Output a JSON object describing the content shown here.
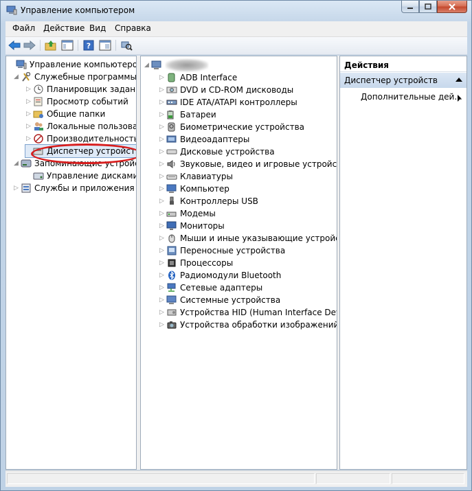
{
  "window": {
    "title": "Управление компьютером"
  },
  "menu": {
    "items": [
      "Файл",
      "Действие",
      "Вид",
      "Справка"
    ]
  },
  "toolbar": {
    "icons": [
      "back-arrow-icon",
      "forward-arrow-icon",
      "up-folder-icon",
      "show-hide-tree-icon",
      "help-icon",
      "properties-icon",
      "scan-hardware-icon"
    ]
  },
  "left_tree": {
    "items": [
      {
        "label": "Управление компьютером (л",
        "icon": "computer-management-icon",
        "expander": "▸"
      },
      {
        "label": "Служебные программы",
        "icon": "tools-icon",
        "expander": "◢"
      },
      {
        "label": "Планировщик заданий",
        "icon": "clock-icon",
        "expander": "▷"
      },
      {
        "label": "Просмотр событий",
        "icon": "event-viewer-icon",
        "expander": "▷"
      },
      {
        "label": "Общие папки",
        "icon": "shared-folder-icon",
        "expander": "▷"
      },
      {
        "label": "Локальные пользовате",
        "icon": "users-icon",
        "expander": "▷"
      },
      {
        "label": "Производительность",
        "icon": "performance-icon",
        "expander": "▷"
      },
      {
        "label": "Диспетчер устройств",
        "icon": "device-manager-icon",
        "expander": ""
      },
      {
        "label": "Запоминающие устройст",
        "icon": "storage-icon",
        "expander": "◢"
      },
      {
        "label": "Управление дисками",
        "icon": "disk-management-icon",
        "expander": ""
      },
      {
        "label": "Службы и приложения",
        "icon": "services-icon",
        "expander": "▷"
      }
    ]
  },
  "device_tree": {
    "root_expander": "◢",
    "items": [
      {
        "label": "ADB Interface",
        "icon": "adb-icon"
      },
      {
        "label": "DVD и CD-ROM дисководы",
        "icon": "dvd-icon"
      },
      {
        "label": "IDE ATA/ATAPI контроллеры",
        "icon": "ide-icon"
      },
      {
        "label": "Батареи",
        "icon": "battery-icon"
      },
      {
        "label": "Биометрические устройства",
        "icon": "biometric-icon"
      },
      {
        "label": "Видеоадаптеры",
        "icon": "video-adapter-icon"
      },
      {
        "label": "Дисковые устройства",
        "icon": "disk-drive-icon"
      },
      {
        "label": "Звуковые, видео и игровые устройства",
        "icon": "sound-icon"
      },
      {
        "label": "Клавиатуры",
        "icon": "keyboard-icon"
      },
      {
        "label": "Компьютер",
        "icon": "computer-icon"
      },
      {
        "label": "Контроллеры USB",
        "icon": "usb-icon"
      },
      {
        "label": "Модемы",
        "icon": "modem-icon"
      },
      {
        "label": "Мониторы",
        "icon": "monitor-icon"
      },
      {
        "label": "Мыши и иные указывающие устройства",
        "icon": "mouse-icon"
      },
      {
        "label": "Переносные устройства",
        "icon": "portable-device-icon"
      },
      {
        "label": "Процессоры",
        "icon": "processor-icon"
      },
      {
        "label": "Радиомодули Bluetooth",
        "icon": "bluetooth-icon"
      },
      {
        "label": "Сетевые адаптеры",
        "icon": "network-adapter-icon"
      },
      {
        "label": "Системные устройства",
        "icon": "system-device-icon"
      },
      {
        "label": "Устройства HID (Human Interface Device",
        "icon": "hid-icon"
      },
      {
        "label": "Устройства обработки изображений",
        "icon": "imaging-icon"
      }
    ]
  },
  "actions": {
    "header": "Действия",
    "section": "Диспетчер устройств",
    "more": "Дополнительные дей..."
  },
  "colors": {
    "highlight_ring": "#d81e1e",
    "selection": "#dfeaf7",
    "section_bg": "#c7d8ec"
  }
}
